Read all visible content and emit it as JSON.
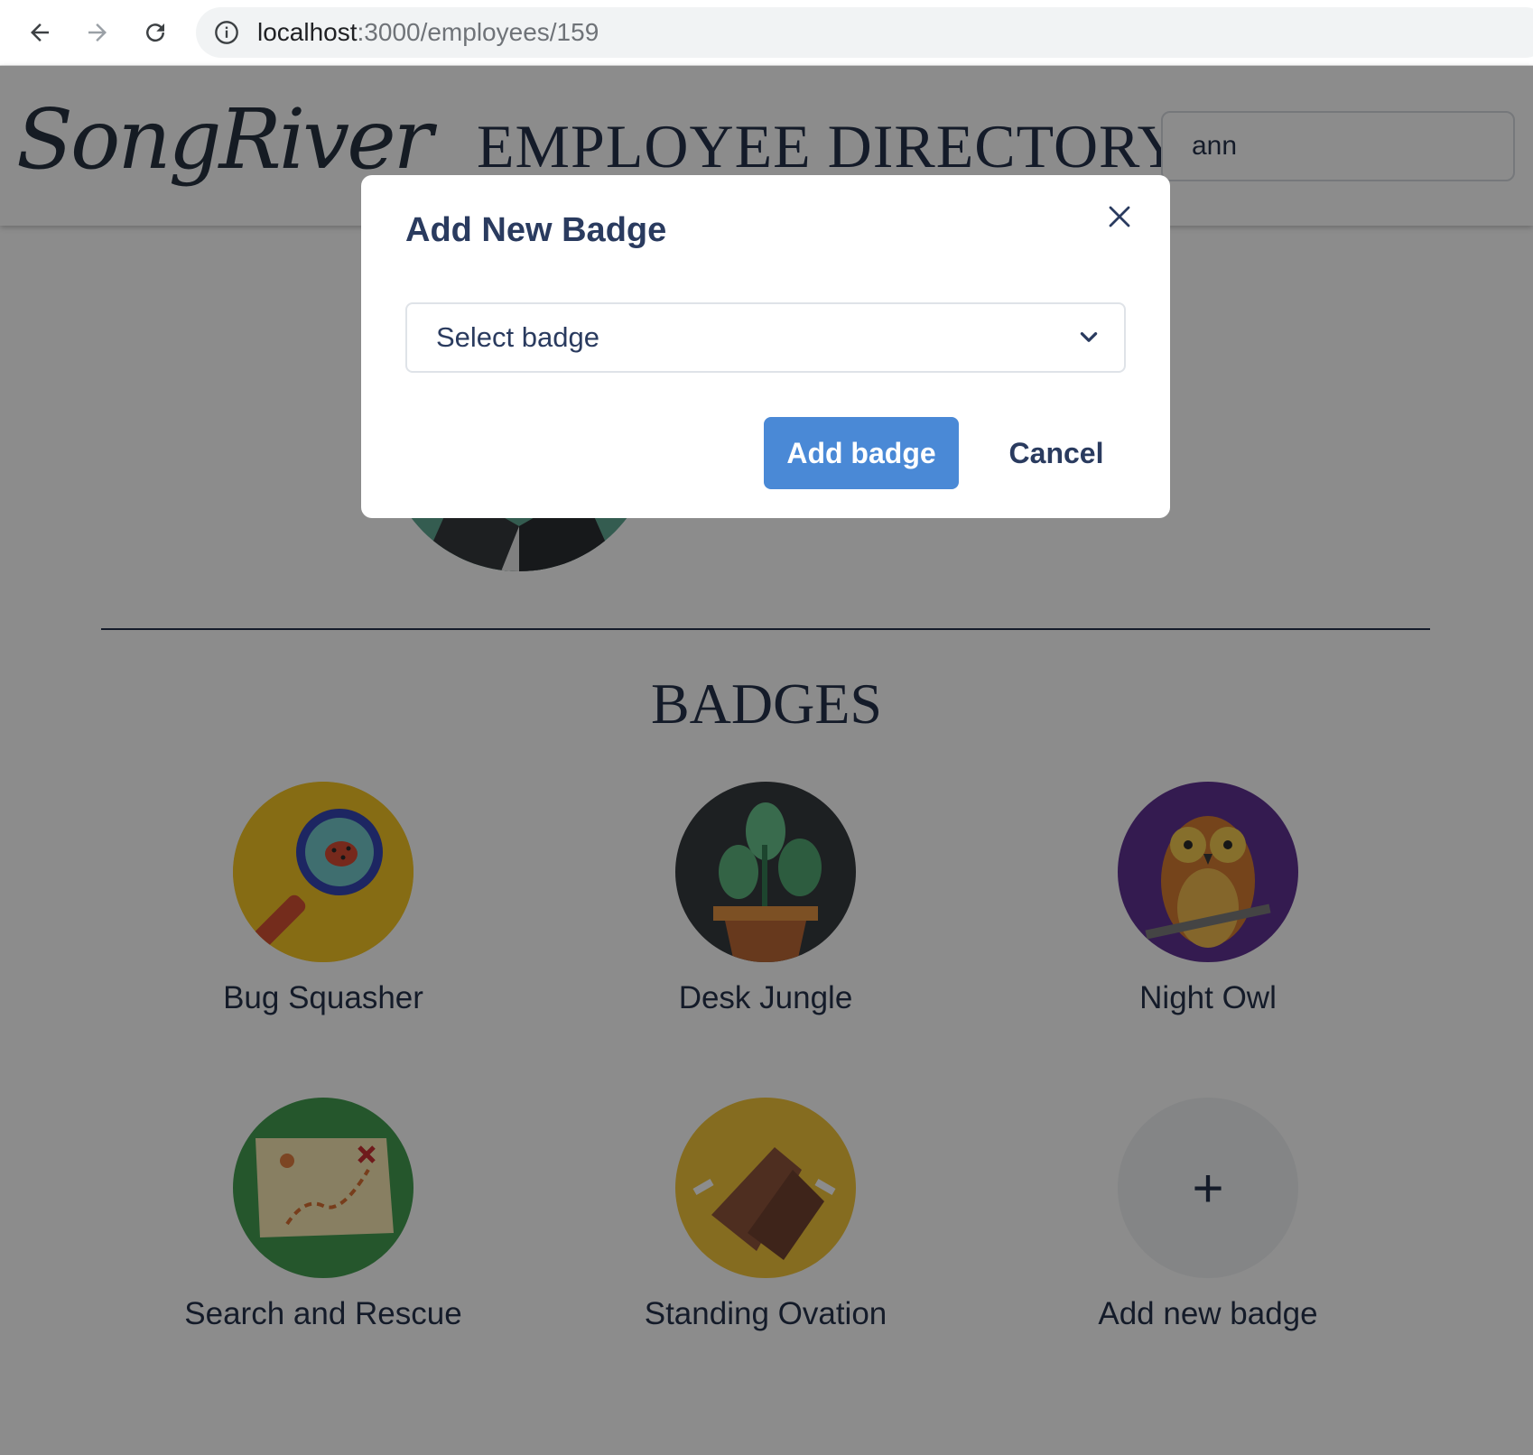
{
  "browser": {
    "url_host": "localhost",
    "url_path": ":3000/employees/159"
  },
  "header": {
    "logo_text": "SongRiver",
    "title": "EMPLOYEE DIRECTORY",
    "search_value": "ann"
  },
  "badges_section": {
    "title": "BADGES",
    "badges": [
      {
        "label": "Bug Squasher"
      },
      {
        "label": "Desk Jungle"
      },
      {
        "label": "Night Owl"
      },
      {
        "label": "Search and Rescue"
      },
      {
        "label": "Standing Ovation"
      }
    ],
    "add_label": "Add new badge",
    "add_symbol": "+"
  },
  "modal": {
    "title": "Add New Badge",
    "select_placeholder": "Select badge",
    "primary_label": "Add badge",
    "cancel_label": "Cancel"
  },
  "colors": {
    "primary": "#4a89d6",
    "text_dark": "#2a3b5f"
  }
}
